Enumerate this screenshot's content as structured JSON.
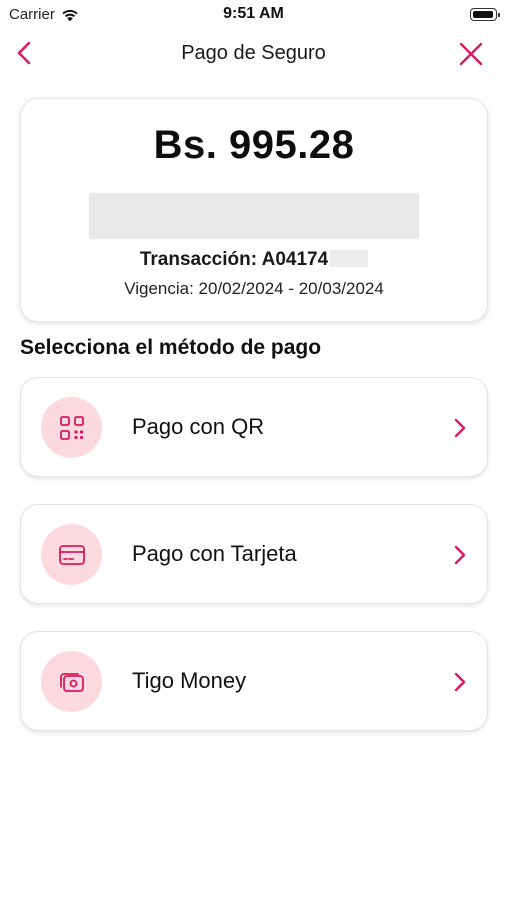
{
  "status_bar": {
    "carrier": "Carrier",
    "time": "9:51 AM"
  },
  "nav": {
    "title": "Pago de Seguro",
    "back_icon": "chevron-left-icon",
    "close_icon": "close-icon"
  },
  "summary": {
    "amount": "Bs. 995.28",
    "transaction_label": "Transacción: A04174",
    "validity": "Vigencia: 20/02/2024 - 20/03/2024"
  },
  "payment": {
    "section_title": "Selecciona el método de pago",
    "methods": [
      {
        "label": "Pago con QR",
        "icon": "qr-code-icon"
      },
      {
        "label": "Pago con Tarjeta",
        "icon": "credit-card-icon"
      },
      {
        "label": "Tigo Money",
        "icon": "wallet-money-icon"
      }
    ]
  },
  "colors": {
    "accent": "#d81b60",
    "icon_circle": "#fcd9de"
  }
}
